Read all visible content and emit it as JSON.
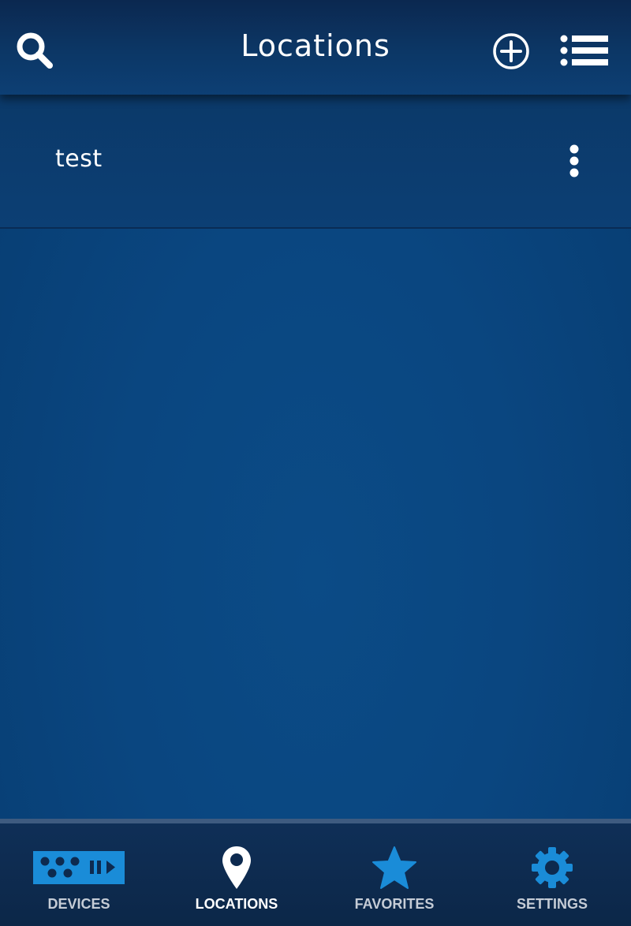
{
  "header": {
    "title": "Locations",
    "search_icon": "search-icon",
    "add_icon": "plus-circle-icon",
    "menu_icon": "list-icon"
  },
  "locations": [
    {
      "label": "test",
      "more_icon": "more-vertical-icon"
    }
  ],
  "tabs": [
    {
      "label": "DEVICES",
      "icon": "devices-icon",
      "active": false
    },
    {
      "label": "LOCATIONS",
      "icon": "location-pin-icon",
      "active": true
    },
    {
      "label": "FAVORITES",
      "icon": "star-icon",
      "active": false
    },
    {
      "label": "SETTINGS",
      "icon": "gear-icon",
      "active": false
    }
  ],
  "colors": {
    "accent": "#1a8cd8",
    "header": "#0c3766",
    "background": "#0a4680",
    "tabbar": "#0e2c52",
    "text": "#ffffff"
  }
}
